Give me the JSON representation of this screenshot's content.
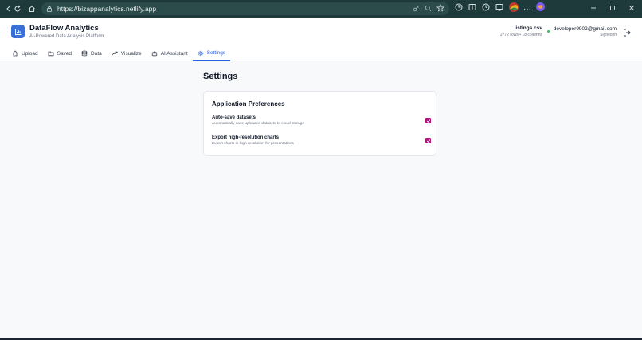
{
  "browser": {
    "url": "https://bizappanalytics.netlify.app"
  },
  "header": {
    "app_title": "DataFlow Analytics",
    "app_subtitle": "AI-Powered Data Analysis Platform",
    "file_name": "listings.csv",
    "file_meta": "2772 rows • 18 columns",
    "user_email": "developer9902@gmail.com",
    "user_status": "Signed in"
  },
  "tabs": [
    {
      "label": "Upload",
      "icon": "upload-icon"
    },
    {
      "label": "Saved",
      "icon": "folder-icon"
    },
    {
      "label": "Data",
      "icon": "database-icon"
    },
    {
      "label": "Visualize",
      "icon": "trend-icon"
    },
    {
      "label": "AI Assistant",
      "icon": "bot-icon"
    },
    {
      "label": "Settings",
      "icon": "gear-icon",
      "active": true
    }
  ],
  "main": {
    "page_title": "Settings",
    "card_title": "Application Preferences",
    "preferences": [
      {
        "label": "Auto-save datasets",
        "description": "Automatically save uploaded datasets to cloud storage",
        "checked": true
      },
      {
        "label": "Export high-resolution charts",
        "description": "Export charts in high resolution for presentations",
        "checked": true
      }
    ]
  },
  "colors": {
    "accent": "#2563eb",
    "logo": "#3b6fd8",
    "checkbox": "#b0137a",
    "status_online": "#22c55e",
    "browser_bar": "#1f3a3a"
  }
}
